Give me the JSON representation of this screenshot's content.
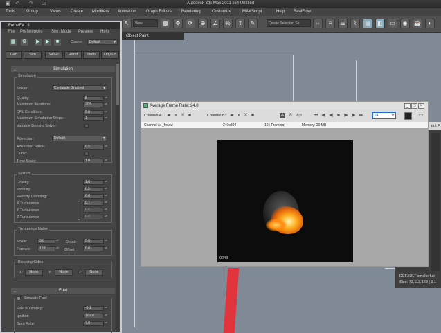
{
  "app": {
    "title": "Autodesk 3ds Max 2011 x64      Untitled"
  },
  "menubar": {
    "items": [
      "Tools",
      "Group",
      "Views",
      "Create",
      "Modifiers",
      "Animation",
      "Graph Editors",
      "Rendering",
      "Customize",
      "MAXScript",
      "Help",
      "RealFlow"
    ]
  },
  "toolbar": {
    "view_dropdown": "View",
    "selection_set": "Create Selection Se"
  },
  "viewport": {
    "label": "Object Paint"
  },
  "fumefx": {
    "title": "FumeFX UI",
    "menu": [
      "File",
      "Preferences",
      "Sim. Mode",
      "Preview",
      "Help"
    ],
    "cache_label": "Cache:",
    "cache_value": "Default",
    "tabs": [
      "Gen",
      "Sim",
      "WT-P",
      "Rend",
      "Illum",
      "Obj/Src"
    ],
    "simulation_header": "Simulation",
    "simulation_group": "Simulation",
    "solver_label": "Solver:",
    "solver_value": "Conjugate Gradient",
    "params": [
      {
        "label": "Quality:",
        "value": "5"
      },
      {
        "label": "Maximum Iterations:",
        "value": "200"
      },
      {
        "label": "CFL Condition:",
        "value": "5.0"
      },
      {
        "label": "Maximum Simulation Steps:",
        "value": "1"
      }
    ],
    "var_density_label": "Variable Density Solver:",
    "advection_label": "Advection:",
    "advection_value": "Default",
    "adv_params": [
      {
        "label": "Advection Stride:",
        "value": "0.5"
      },
      {
        "label": "Cubic:",
        "value": ""
      },
      {
        "label": "Time Scale:",
        "value": "1.0"
      }
    ],
    "system_group": "System",
    "system_params": [
      {
        "label": "Gravity:",
        "value": "1.0"
      },
      {
        "label": "Vorticity:",
        "value": "0.5"
      },
      {
        "label": "Velocity Damping:",
        "value": "0.0"
      },
      {
        "label": "X Turbulence",
        "value": "0.7"
      },
      {
        "label": "Y Turbulence",
        "value": "0.0"
      },
      {
        "label": "Z Turbulence",
        "value": "0.0"
      }
    ],
    "turb_group": "Turbulence Noise",
    "scale_label": "Scale:",
    "scale_value": "3.0",
    "detail_label": "Detail:",
    "detail_value": "5.0",
    "frames_label": "Frames:",
    "frames_value": "10.0",
    "offset_label": "Offset:",
    "offset_value": "0.0",
    "blocking_group": "Blocking Sides",
    "blocking": [
      {
        "axis": "X:",
        "value": "None"
      },
      {
        "axis": "Y:",
        "value": "None"
      },
      {
        "axis": "Z:",
        "value": "None"
      }
    ],
    "fuel_header": "Fuel",
    "simulate_fuel_label": "Simulate Fuel",
    "fuel_params": [
      {
        "label": "Fuel Buoyancy:",
        "value": "-0.1"
      },
      {
        "label": "Ignition",
        "value": "100.0"
      },
      {
        "label": "Burn Rate:",
        "value": "7.0"
      }
    ]
  },
  "framebuffer": {
    "title": "Average Frame Rate: 24.0",
    "channel_a_label": "Channel A:",
    "channel_b_label": "Channel B:",
    "frame_field": "24",
    "info": {
      "channel": "Channel A:  _ffx.avi",
      "resolution": "340x304",
      "frames": "101 Frame(s)",
      "memory": "Memory: 30 MB"
    },
    "frame_number": "0043"
  },
  "right_panel": {
    "title": "put F",
    "line1": "DEFAULT smoke fuel",
    "line2": "Size: 73,112,128  |  0.1"
  }
}
